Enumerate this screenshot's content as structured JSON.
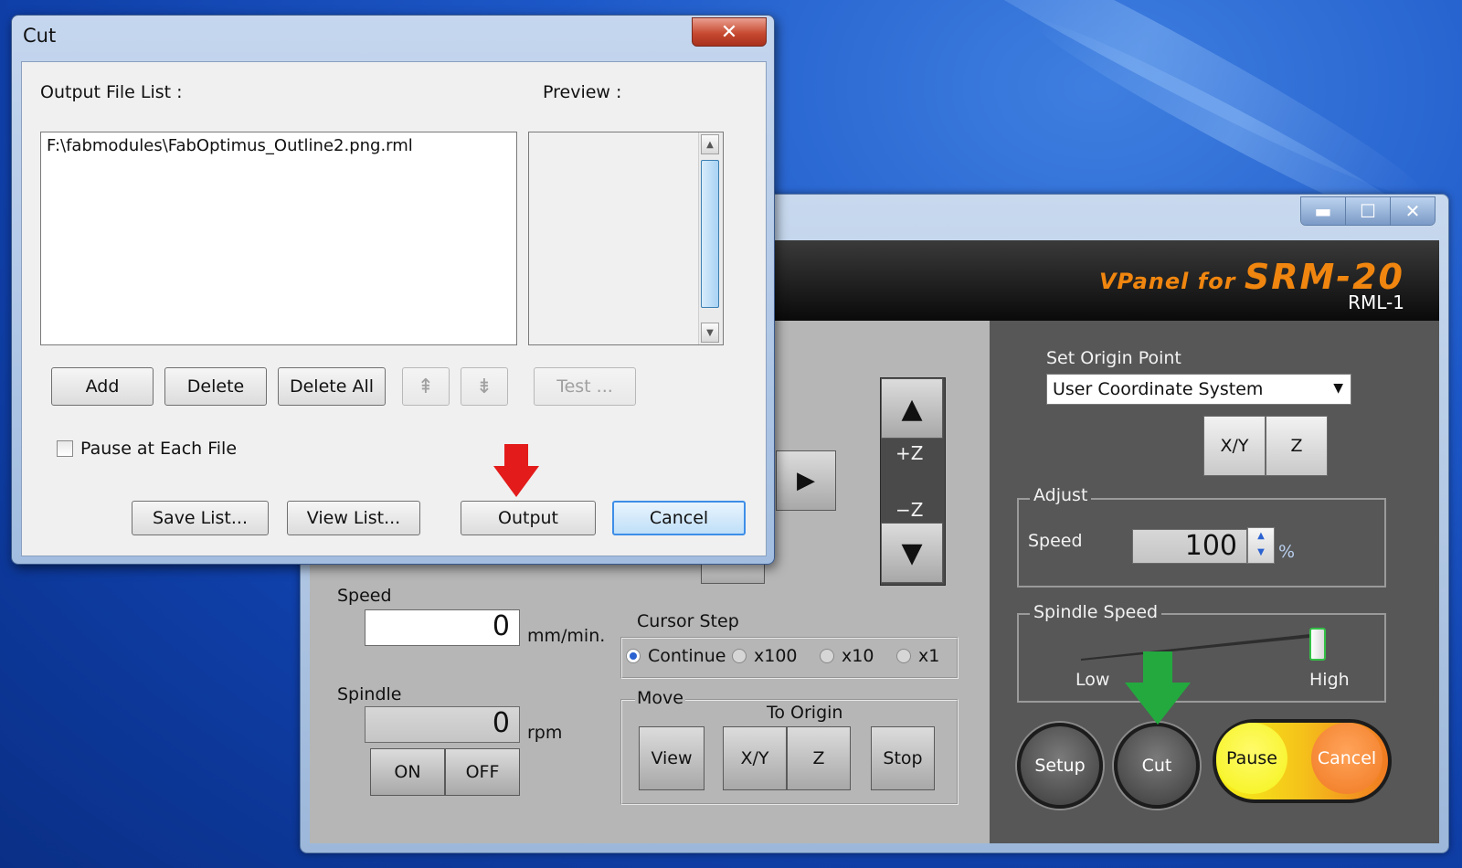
{
  "cut_dialog": {
    "title": "Cut",
    "close_glyph": "✕",
    "output_file_list_label": "Output File List :",
    "preview_label": "Preview :",
    "files": [
      "F:\\fabmodules\\FabOptimus_Outline2.png.rml"
    ],
    "buttons": {
      "add": "Add",
      "delete": "Delete",
      "delete_all": "Delete All",
      "move_up_glyph": "⇞",
      "move_down_glyph": "⇟",
      "test": "Test ...",
      "save_list": "Save List...",
      "view_list": "View List...",
      "output": "Output",
      "cancel": "Cancel"
    },
    "pause_checkbox": {
      "label": "Pause at Each File",
      "checked": false
    }
  },
  "vpanel": {
    "window_controls": {
      "minimize": "▬",
      "maximize": "☐",
      "close": "✕"
    },
    "brand_prefix": "VPanel for",
    "brand_model": "SRM-20",
    "subtitle": "RML-1",
    "brand_color": "#f0860f",
    "z_buttons": {
      "up": "▲",
      "plus_z": "+Z",
      "minus_z": "−Z",
      "down": "▼"
    },
    "right_arrow": "▶",
    "speed": {
      "label": "Speed",
      "value": "0",
      "unit": "mm/min."
    },
    "spindle": {
      "label": "Spindle",
      "value": "0",
      "unit": "rpm",
      "on": "ON",
      "off": "OFF"
    },
    "cursor_step": {
      "label": "Cursor Step",
      "options": [
        "Continue",
        "x100",
        "x10",
        "x1"
      ],
      "selected": "Continue"
    },
    "move": {
      "label": "Move",
      "to_origin_label": "To Origin",
      "view": "View",
      "xy": "X/Y",
      "z": "Z",
      "stop": "Stop"
    },
    "set_origin": {
      "label": "Set Origin Point",
      "selected": "User Coordinate System",
      "xy": "X/Y",
      "z": "Z"
    },
    "adjust": {
      "label": "Adjust",
      "speed_label": "Speed",
      "speed_value": "100",
      "unit": "%"
    },
    "spindle_speed": {
      "label": "Spindle Speed",
      "low": "Low",
      "high": "High",
      "level_fraction": 1.0
    },
    "bottom_buttons": {
      "setup": "Setup",
      "cut": "Cut",
      "pause": "Pause",
      "cancel": "Cancel"
    },
    "pause_color": "#f5f21a",
    "cancel_color": "#f07a22"
  },
  "annotations": {
    "red_arrow_color": "#e31b1b",
    "green_arrow_color": "#23a93e"
  }
}
